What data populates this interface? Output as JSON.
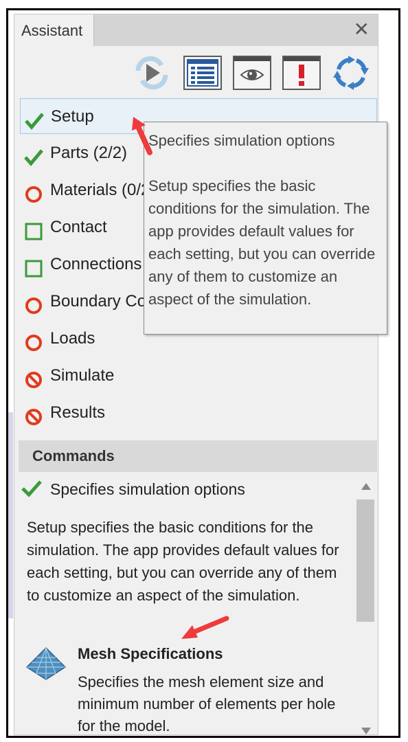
{
  "panel": {
    "tab_title": "Assistant",
    "close_glyph": "✕"
  },
  "toolbar": [
    {
      "name": "update-simulation-icon",
      "icon": "refresh-play"
    },
    {
      "name": "list-view-icon",
      "icon": "list"
    },
    {
      "name": "view-icon",
      "icon": "eye"
    },
    {
      "name": "alert-icon",
      "icon": "exclamation"
    },
    {
      "name": "sync-icon",
      "icon": "circular-arrows"
    }
  ],
  "steps": [
    {
      "label": "Setup",
      "status": "check"
    },
    {
      "label": "Parts (2/2)",
      "status": "check"
    },
    {
      "label": "Materials (0/2",
      "status": "ring"
    },
    {
      "label": "Contact",
      "status": "square"
    },
    {
      "label": "Connections",
      "status": "square"
    },
    {
      "label": "Boundary Con",
      "status": "ring"
    },
    {
      "label": "Loads",
      "status": "ring"
    },
    {
      "label": "Simulate",
      "status": "blocked"
    },
    {
      "label": "Results",
      "status": "blocked"
    }
  ],
  "tooltip": {
    "title": "Specifies simulation options",
    "body": "Setup specifies the basic conditions for the simulation. The app provides default values for each setting, but you can override any of them to customize an aspect of the simulation."
  },
  "commands": {
    "header": "Commands",
    "line": "Specifies simulation options",
    "description": "Setup specifies the basic conditions for the simulation. The app provides default values for each setting, but you can override any of them to customize an aspect of the simulation.",
    "mesh_title": "Mesh Specifications",
    "mesh_desc": "Specifies the mesh element size and minimum number of elements per hole for the model."
  },
  "colors": {
    "check": "#3a9a3a",
    "ring": "#e03b1c",
    "square": "#3a9a3a",
    "blocked": "#e03b1c",
    "annotation_arrow": "#ee3b3b"
  }
}
